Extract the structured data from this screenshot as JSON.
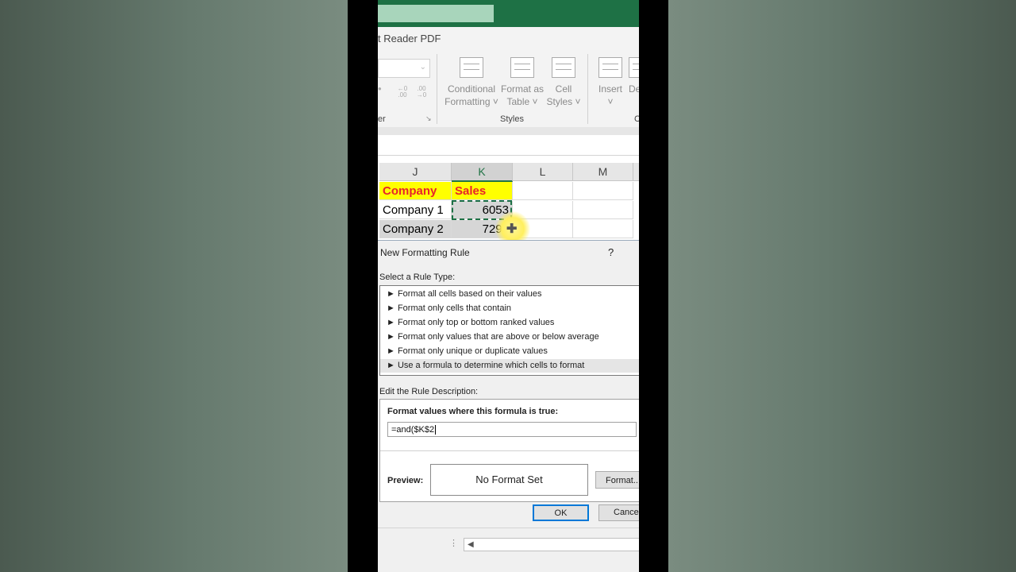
{
  "ribbon": {
    "tab_fragment": "t Reader PDF",
    "number_group_fragment": "er",
    "styles_group": "Styles",
    "cells_group_fragment": "C",
    "conditional_formatting": [
      "Conditional",
      "Formatting ˅"
    ],
    "format_as_table": [
      "Format as",
      "Table ˅"
    ],
    "cell_styles": [
      "Cell",
      "Styles ˅"
    ],
    "insert": [
      "Insert",
      "˅"
    ],
    "delete_fragment": "De",
    "decimal_increase": "←0\n.00",
    "decimal_decrease": ".00\n→0"
  },
  "sheet": {
    "columns": [
      "J",
      "K",
      "L",
      "M"
    ],
    "selected_column": "K",
    "header_row": [
      "Company",
      "Sales"
    ],
    "rows": [
      [
        "Company 1",
        "6053"
      ],
      [
        "Company 2",
        "7297"
      ]
    ]
  },
  "dialog": {
    "title": "New Formatting Rule",
    "help": "?",
    "select_rule_type_label": "Select a Rule Type:",
    "rule_types": [
      "► Format all cells based on their values",
      "► Format only cells that contain",
      "► Format only top or bottom ranked values",
      "► Format only values that are above or below average",
      "► Format only unique or duplicate values",
      "► Use a formula to determine which cells to format"
    ],
    "selected_rule_index": 5,
    "edit_description_label": "Edit the Rule Description:",
    "formula_label": "Format values where this formula is true:",
    "formula_value": "=and($K$2",
    "preview_label": "Preview:",
    "preview_text": "No Format Set",
    "format_button": "Format...",
    "ok_button": "OK",
    "cancel_button": "Cance"
  },
  "colors": {
    "excel_green": "#1e7145",
    "header_fill": "#ffff00",
    "header_text": "#e8232b",
    "focus_blue": "#0078d7"
  }
}
